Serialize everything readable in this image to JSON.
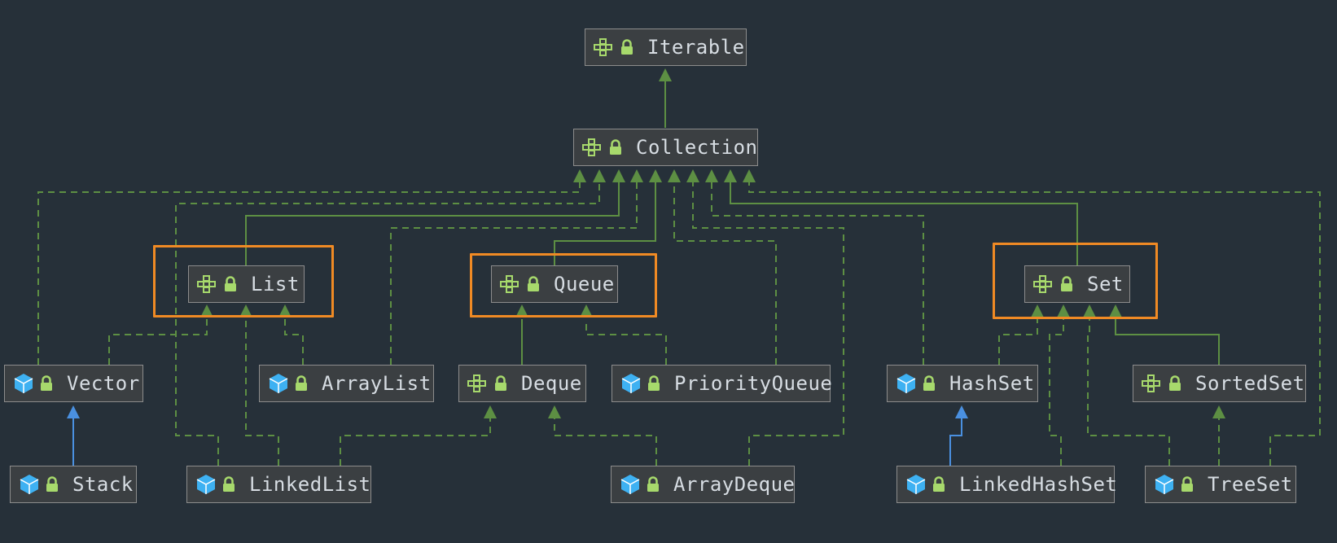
{
  "colors": {
    "background": "#263039",
    "node_fill": "#3b3f42",
    "node_border": "#8c8c8c",
    "edge_green": "#5d8f43",
    "edge_blue": "#4a90e0",
    "highlight": "#f08a24",
    "interface_icon": "#a7d96c",
    "class_icon": "#3eb1f2",
    "lock_icon": "#a7d96c"
  },
  "nodes": {
    "iterable": {
      "label": "Iterable",
      "kind": "interface",
      "icon": "interface-icon"
    },
    "collection": {
      "label": "Collection",
      "kind": "interface",
      "icon": "interface-icon"
    },
    "list": {
      "label": "List",
      "kind": "interface",
      "icon": "interface-icon"
    },
    "queue": {
      "label": "Queue",
      "kind": "interface",
      "icon": "interface-icon"
    },
    "set": {
      "label": "Set",
      "kind": "interface",
      "icon": "interface-icon"
    },
    "vector": {
      "label": "Vector",
      "kind": "class",
      "icon": "class-icon"
    },
    "arraylist": {
      "label": "ArrayList",
      "kind": "class",
      "icon": "class-icon"
    },
    "deque": {
      "label": "Deque",
      "kind": "interface",
      "icon": "interface-icon"
    },
    "priorityqueue": {
      "label": "PriorityQueue",
      "kind": "class",
      "icon": "class-icon"
    },
    "hashset": {
      "label": "HashSet",
      "kind": "class",
      "icon": "class-icon"
    },
    "sortedset": {
      "label": "SortedSet",
      "kind": "interface",
      "icon": "interface-icon"
    },
    "stack": {
      "label": "Stack",
      "kind": "class",
      "icon": "class-icon"
    },
    "linkedlist": {
      "label": "LinkedList",
      "kind": "class",
      "icon": "class-icon"
    },
    "arraydeque": {
      "label": "ArrayDeque",
      "kind": "class",
      "icon": "class-icon"
    },
    "linkedhashset": {
      "label": "LinkedHashSet",
      "kind": "class",
      "icon": "class-icon"
    },
    "treeset": {
      "label": "TreeSet",
      "kind": "class",
      "icon": "class-icon"
    }
  },
  "highlighted_groups": [
    "list",
    "queue",
    "set"
  ],
  "edges": [
    {
      "from": "collection",
      "to": "iterable",
      "style": "extends"
    },
    {
      "from": "vector",
      "to": "collection",
      "style": "implements"
    },
    {
      "from": "linkedlist",
      "to": "collection",
      "style": "implements"
    },
    {
      "from": "list",
      "to": "collection",
      "style": "extends"
    },
    {
      "from": "arraylist",
      "to": "collection",
      "style": "implements"
    },
    {
      "from": "queue",
      "to": "collection",
      "style": "extends"
    },
    {
      "from": "priorityqueue",
      "to": "collection",
      "style": "implements"
    },
    {
      "from": "arraydeque",
      "to": "collection",
      "style": "implements"
    },
    {
      "from": "hashset",
      "to": "collection",
      "style": "implements"
    },
    {
      "from": "set",
      "to": "collection",
      "style": "extends"
    },
    {
      "from": "treeset",
      "to": "collection",
      "style": "implements"
    },
    {
      "from": "vector",
      "to": "list",
      "style": "implements"
    },
    {
      "from": "linkedlist",
      "to": "list",
      "style": "implements"
    },
    {
      "from": "arraylist",
      "to": "list",
      "style": "implements"
    },
    {
      "from": "deque",
      "to": "queue",
      "style": "extends"
    },
    {
      "from": "priorityqueue",
      "to": "queue",
      "style": "implements"
    },
    {
      "from": "linkedlist",
      "to": "deque",
      "style": "implements"
    },
    {
      "from": "arraydeque",
      "to": "deque",
      "style": "implements"
    },
    {
      "from": "stack",
      "to": "vector",
      "style": "class-extends"
    },
    {
      "from": "hashset",
      "to": "set",
      "style": "implements"
    },
    {
      "from": "linkedhashset",
      "to": "set",
      "style": "implements"
    },
    {
      "from": "treeset",
      "to": "set",
      "style": "implements"
    },
    {
      "from": "sortedset",
      "to": "set",
      "style": "extends"
    },
    {
      "from": "treeset",
      "to": "sortedset",
      "style": "implements"
    },
    {
      "from": "linkedhashset",
      "to": "hashset",
      "style": "class-extends"
    }
  ]
}
